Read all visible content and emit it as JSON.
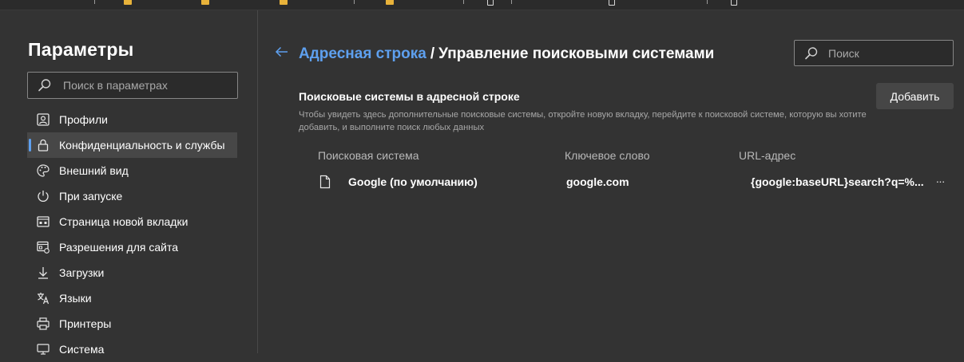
{
  "sidebar": {
    "title": "Параметры",
    "search_placeholder": "Поиск в параметрах",
    "items": [
      {
        "label": "Профили",
        "icon": "profile-icon"
      },
      {
        "label": "Конфиденциальность и службы",
        "icon": "lock-icon",
        "active": true
      },
      {
        "label": "Внешний вид",
        "icon": "palette-icon"
      },
      {
        "label": "При запуске",
        "icon": "power-icon"
      },
      {
        "label": "Страница новой вкладки",
        "icon": "new-tab-page-icon"
      },
      {
        "label": "Разрешения для сайта",
        "icon": "site-permissions-icon"
      },
      {
        "label": "Загрузки",
        "icon": "download-icon"
      },
      {
        "label": "Языки",
        "icon": "languages-icon"
      },
      {
        "label": "Принтеры",
        "icon": "printer-icon"
      },
      {
        "label": "Система",
        "icon": "system-icon"
      }
    ]
  },
  "main": {
    "breadcrumb": {
      "parent": "Адресная строка",
      "separator": "/",
      "current": "Управление поисковыми системами"
    },
    "search_placeholder": "Поиск",
    "section": {
      "title": "Поисковые системы в адресной строке",
      "description": "Чтобы увидеть здесь дополнительные поисковые системы, откройте новую вкладку, перейдите к поисковой системе, которую вы хотите добавить, и выполните поиск любых данных",
      "add_button": "Добавить"
    },
    "table": {
      "headers": [
        "Поисковая система",
        "Ключевое слово",
        "URL-адрес"
      ],
      "rows": [
        {
          "engine": "Google (по умолчанию)",
          "keyword": "google.com",
          "url": "{google:baseURL}search?q=%...",
          "more": "···"
        }
      ]
    }
  },
  "colors": {
    "accent": "#5ea0ef",
    "background": "#333333",
    "active_item": "#474747",
    "button": "#464646"
  }
}
